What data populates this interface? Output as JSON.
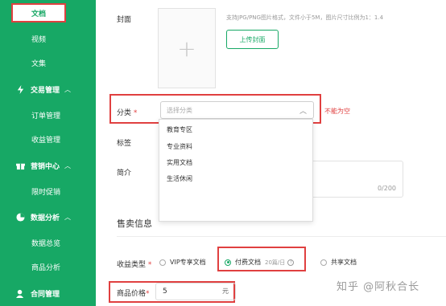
{
  "sidebar": {
    "active_item": "文档",
    "items": [
      {
        "label": "视频",
        "type": "sub"
      },
      {
        "label": "文集",
        "type": "sub"
      },
      {
        "label": "交易管理",
        "type": "group"
      },
      {
        "label": "订单管理",
        "type": "sub"
      },
      {
        "label": "收益管理",
        "type": "sub"
      },
      {
        "label": "营销中心",
        "type": "group"
      },
      {
        "label": "限时促销",
        "type": "sub"
      },
      {
        "label": "数据分析",
        "type": "group"
      },
      {
        "label": "数据总览",
        "type": "sub"
      },
      {
        "label": "商品分析",
        "type": "sub"
      },
      {
        "label": "合同管理",
        "type": "group"
      }
    ]
  },
  "form": {
    "cover_label": "封面",
    "cover_plus": "+",
    "cover_hint": "支持JPG/PNG图片格式，文件小于5M，图片尺寸比例为1：1.4",
    "upload_button": "上传封面",
    "category_label": "分类",
    "required_mark": "*",
    "category_placeholder": "选择分类",
    "category_error": "不能为空",
    "category_options": [
      "教育专区",
      "专业资料",
      "实用文档",
      "生活休闲"
    ],
    "tags_label": "标签",
    "intro_label": "简介",
    "intro_counter": "0/200"
  },
  "sale": {
    "section_title": "售卖信息",
    "revenue_label": "收益类型",
    "options": [
      {
        "label": "VIP专享文档",
        "selected": false
      },
      {
        "label": "付费文档",
        "selected": true,
        "note": "20篇/日"
      },
      {
        "label": "共享文档",
        "selected": false
      }
    ],
    "price_label": "商品价格",
    "price_value": "5",
    "price_unit": "元"
  },
  "watermark": "知乎 @阿秋合长",
  "colors": {
    "brand": "#17a865",
    "error": "#e04040"
  }
}
